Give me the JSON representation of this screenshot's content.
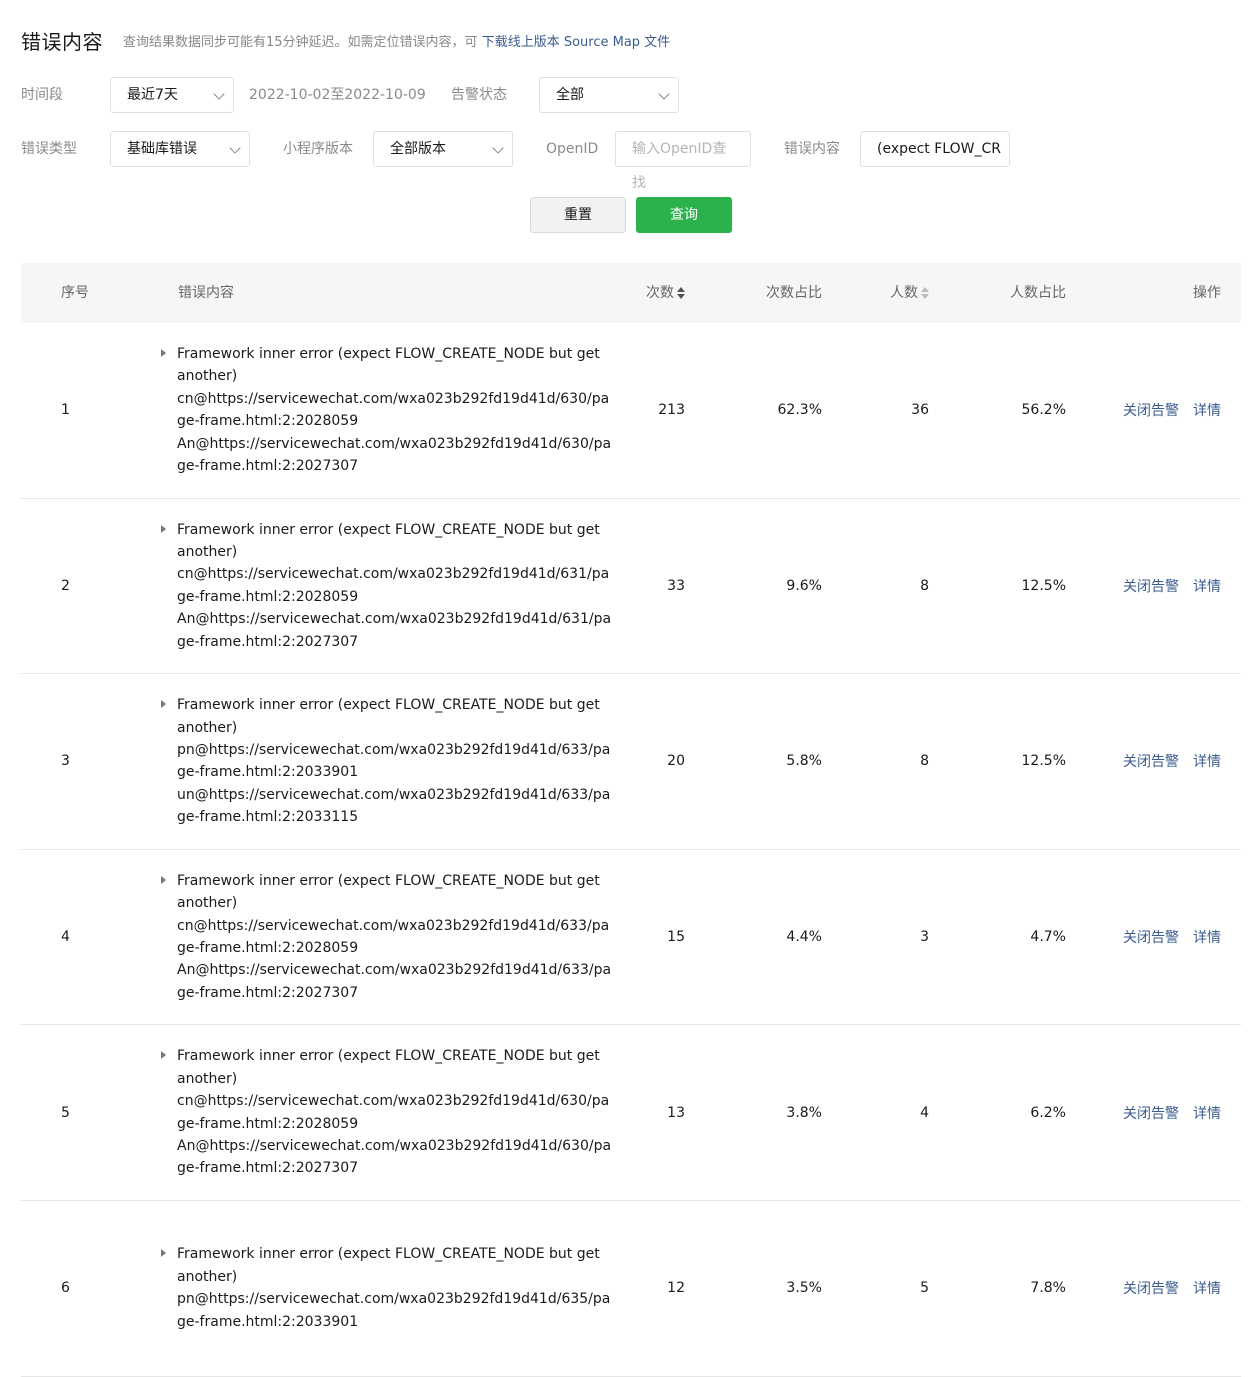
{
  "header": {
    "title": "错误内容",
    "note": "查询结果数据同步可能有15分钟延迟。如需定位错误内容，可",
    "link": "下载线上版本 Source Map 文件"
  },
  "filters": {
    "period_label": "时间段",
    "period_value": "最近7天",
    "date_range": "2022-10-02至2022-10-09",
    "alert_label": "告警状态",
    "alert_value": "全部",
    "type_label": "错误类型",
    "type_value": "基础库错误",
    "version_label": "小程序版本",
    "version_value": "全部版本",
    "openid_label": "OpenID",
    "openid_placeholder": "输入OpenID查找",
    "content_label": "错误内容",
    "content_value": "(expect FLOW_CR"
  },
  "buttons": {
    "reset": "重置",
    "query": "查询"
  },
  "table": {
    "columns": {
      "index": "序号",
      "message": "错误内容",
      "count": "次数",
      "count_pct": "次数占比",
      "users": "人数",
      "users_pct": "人数占比",
      "ops": "操作"
    },
    "actions": {
      "close_alert": "关闭告警",
      "detail": "详情"
    },
    "rows": [
      {
        "index": "1",
        "lines": [
          "Framework inner error (expect FLOW_CREATE_NODE but get",
          "another)",
          "cn@https://servicewechat.com/wxa023b292fd19d41d/630/pa",
          "ge-frame.html:2:2028059",
          "An@https://servicewechat.com/wxa023b292fd19d41d/630/pa",
          "ge-frame.html:2:2027307"
        ],
        "count": "213",
        "count_pct": "62.3%",
        "users": "36",
        "users_pct": "56.2%"
      },
      {
        "index": "2",
        "lines": [
          "Framework inner error (expect FLOW_CREATE_NODE but get",
          "another)",
          "cn@https://servicewechat.com/wxa023b292fd19d41d/631/pa",
          "ge-frame.html:2:2028059",
          "An@https://servicewechat.com/wxa023b292fd19d41d/631/pa",
          "ge-frame.html:2:2027307"
        ],
        "count": "33",
        "count_pct": "9.6%",
        "users": "8",
        "users_pct": "12.5%"
      },
      {
        "index": "3",
        "lines": [
          "Framework inner error (expect FLOW_CREATE_NODE but get",
          "another)",
          "pn@https://servicewechat.com/wxa023b292fd19d41d/633/pa",
          "ge-frame.html:2:2033901",
          "un@https://servicewechat.com/wxa023b292fd19d41d/633/pa",
          "ge-frame.html:2:2033115"
        ],
        "count": "20",
        "count_pct": "5.8%",
        "users": "8",
        "users_pct": "12.5%"
      },
      {
        "index": "4",
        "lines": [
          "Framework inner error (expect FLOW_CREATE_NODE but get",
          "another)",
          "cn@https://servicewechat.com/wxa023b292fd19d41d/633/pa",
          "ge-frame.html:2:2028059",
          "An@https://servicewechat.com/wxa023b292fd19d41d/633/pa",
          "ge-frame.html:2:2027307"
        ],
        "count": "15",
        "count_pct": "4.4%",
        "users": "3",
        "users_pct": "4.7%"
      },
      {
        "index": "5",
        "lines": [
          "Framework inner error (expect FLOW_CREATE_NODE but get",
          "another)",
          "cn@https://servicewechat.com/wxa023b292fd19d41d/630/pa",
          "ge-frame.html:2:2028059",
          "An@https://servicewechat.com/wxa023b292fd19d41d/630/pa",
          "ge-frame.html:2:2027307"
        ],
        "count": "13",
        "count_pct": "3.8%",
        "users": "4",
        "users_pct": "6.2%"
      },
      {
        "index": "6",
        "lines": [
          "Framework inner error (expect FLOW_CREATE_NODE but get",
          "another)",
          "pn@https://servicewechat.com/wxa023b292fd19d41d/635/pa",
          "ge-frame.html:2:2033901"
        ],
        "count": "12",
        "count_pct": "3.5%",
        "users": "5",
        "users_pct": "7.8%"
      }
    ]
  }
}
